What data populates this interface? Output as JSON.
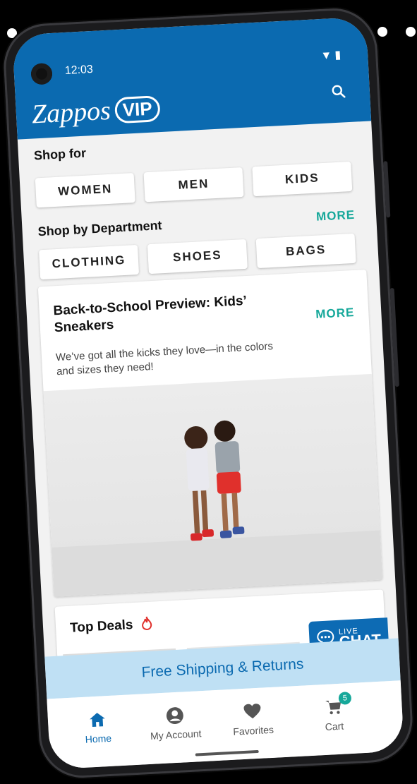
{
  "status": {
    "time": "12:03"
  },
  "header": {
    "logo_text": "Zappos",
    "logo_badge": "VIP",
    "search_icon": "search-icon"
  },
  "shop_for": {
    "title": "Shop for",
    "options": [
      "WOMEN",
      "MEN",
      "KIDS"
    ]
  },
  "department": {
    "title": "Shop by Department",
    "more": "MORE",
    "options": [
      "CLOTHING",
      "SHOES",
      "BAGS"
    ]
  },
  "promo": {
    "title": "Back-to-School Preview: Kids’ Sneakers",
    "more": "MORE",
    "description": "We’ve got all the kicks they love—in the colors and sizes they need!"
  },
  "top_deals": {
    "title": "Top Deals",
    "icon": "flame-icon"
  },
  "chat": {
    "live": "LIVE",
    "chat": "CHAT"
  },
  "shipping_banner": "Free Shipping & Returns",
  "tabs": [
    {
      "label": "Home",
      "icon": "home-icon"
    },
    {
      "label": "My Account",
      "icon": "account-icon"
    },
    {
      "label": "Favorites",
      "icon": "heart-icon"
    },
    {
      "label": "Cart",
      "icon": "cart-icon",
      "badge": "5"
    }
  ],
  "colors": {
    "brand_blue": "#0b6ab0",
    "accent_teal": "#16a89a",
    "banner_blue": "#bfe0f4"
  }
}
